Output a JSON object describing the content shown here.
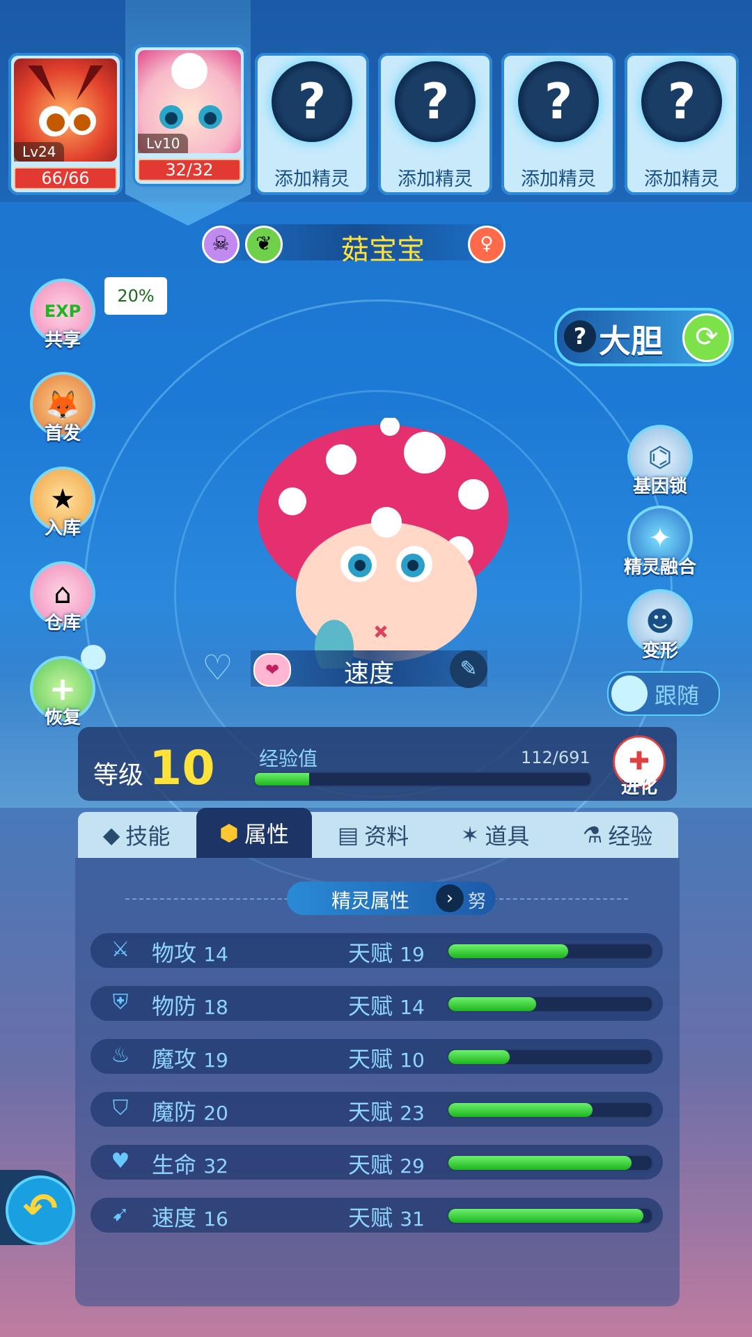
{
  "team": {
    "slots": [
      {
        "level": "Lv24",
        "hp": "66/66"
      },
      {
        "level": "Lv10",
        "hp": "32/32"
      }
    ],
    "empty_label": "添加精灵",
    "empty_mark": "?"
  },
  "pet": {
    "name": "菇宝宝",
    "nature": "速度",
    "personality": "大胆",
    "follow": "跟随"
  },
  "left_menu": {
    "share": "共享",
    "share_badge": "EXP",
    "share_pct": "20%",
    "first": "首发",
    "store": "入库",
    "warehouse": "仓库",
    "recover": "恢复"
  },
  "right_menu": {
    "gene": "基因锁",
    "fusion": "精灵融合",
    "transform": "变形"
  },
  "level": {
    "label": "等级",
    "value": "10",
    "exp_label": "经验值",
    "exp_text": "112/691",
    "exp_fraction": 0.162,
    "evolve": "进化"
  },
  "tabs": [
    "技能",
    "属性",
    "资料",
    "道具",
    "经验"
  ],
  "active_tab": "属性",
  "section": {
    "title": "精灵属性",
    "suffix": "努"
  },
  "talent_label": "天赋",
  "stats": [
    {
      "name": "物攻",
      "value": "14",
      "talent": "19",
      "fraction": 0.59
    },
    {
      "name": "物防",
      "value": "18",
      "talent": "14",
      "fraction": 0.43
    },
    {
      "name": "魔攻",
      "value": "19",
      "talent": "10",
      "fraction": 0.3
    },
    {
      "name": "魔防",
      "value": "20",
      "talent": "23",
      "fraction": 0.71
    },
    {
      "name": "生命",
      "value": "32",
      "talent": "29",
      "fraction": 0.9
    },
    {
      "name": "速度",
      "value": "16",
      "talent": "31",
      "fraction": 0.96
    }
  ],
  "colors": {
    "accent": "#5ad3ff",
    "name": "#ffe23a",
    "bar": "#2ec93a",
    "hp": "#e23a32"
  }
}
